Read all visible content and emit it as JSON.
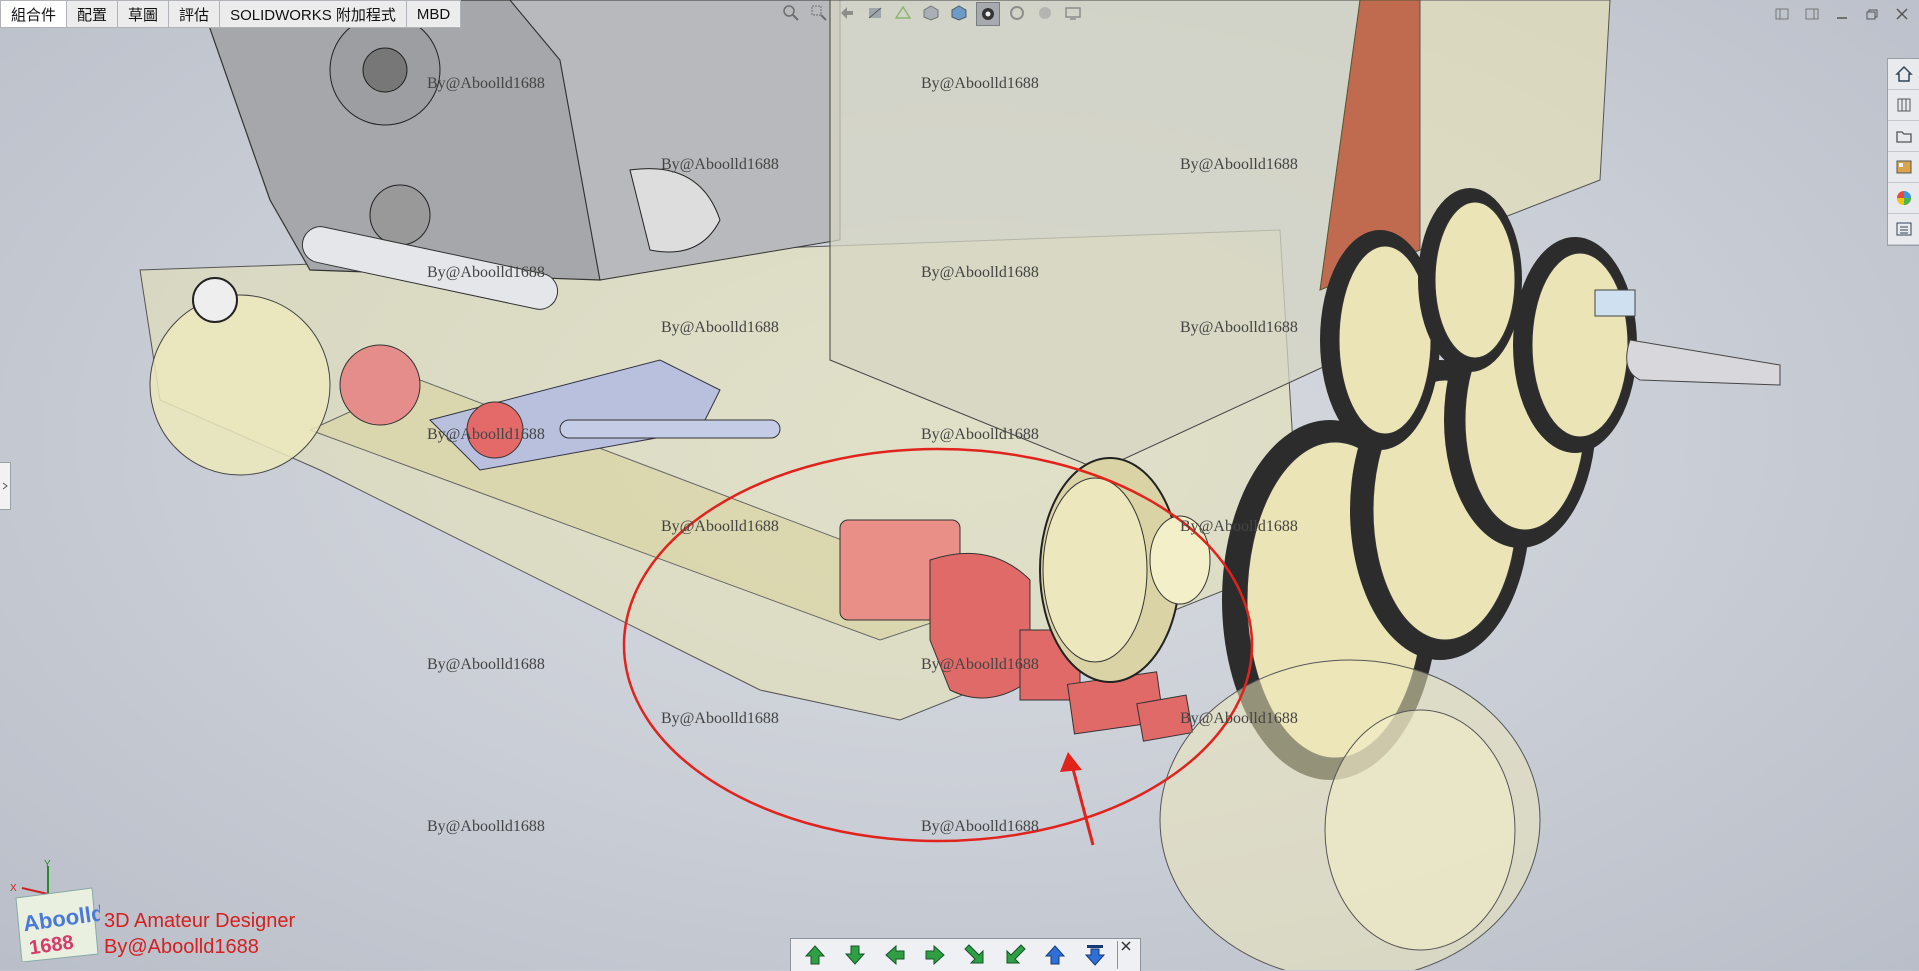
{
  "tabs": [
    "組合件",
    "配置",
    "草圖",
    "評估",
    "SOLIDWORKS 附加程式",
    "MBD"
  ],
  "watermark_text": "By@Aboolld1688",
  "branding": {
    "line1": "3D Amateur Designer",
    "line2": "By@Aboolld1688"
  },
  "logo": {
    "text_top": "Aboolld",
    "text_bottom": "1688",
    "triad_x": "X",
    "triad_y": "Y"
  },
  "annotation_color": "#e0231c",
  "hud_icons": [
    "zoom-to-fit-icon",
    "zoom-area-icon",
    "previous-view-icon",
    "section-view-icon",
    "dynamic-annotation-icon",
    "view-orientation-icon",
    "display-style-icon",
    "hide-show-icon",
    "edit-appearance-icon",
    "apply-scene-icon",
    "view-settings-icon"
  ],
  "taskpane_icons": [
    "home-icon",
    "design-library-icon",
    "file-explorer-icon",
    "view-palette-icon",
    "appearances-icon",
    "custom-properties-icon"
  ],
  "nav_icons": [
    "move-up-icon",
    "move-down-icon",
    "move-left-icon",
    "move-right-icon",
    "rotate-cw-icon",
    "rotate-ccw-icon",
    "expand-up-icon",
    "collapse-down-icon"
  ]
}
